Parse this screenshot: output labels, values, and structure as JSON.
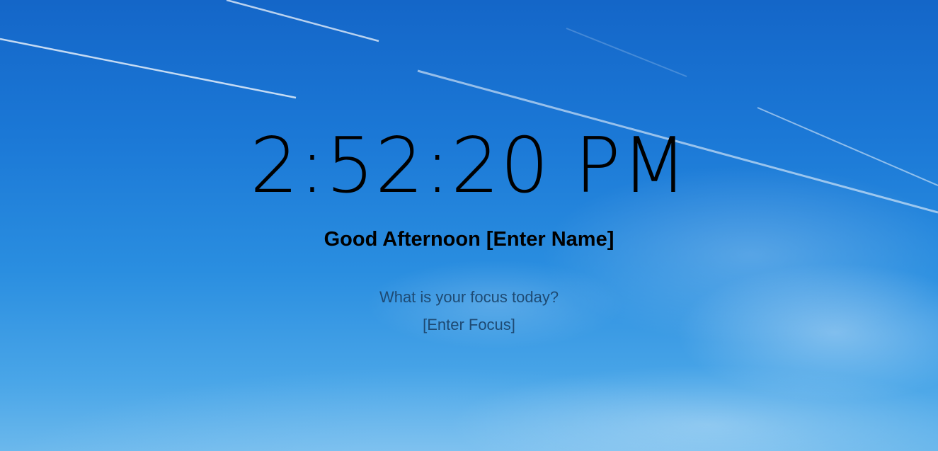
{
  "clock": {
    "time": "2:52:20 PM"
  },
  "greeting": {
    "salutation": "Good Afternoon",
    "name_placeholder": "[Enter Name]"
  },
  "focus": {
    "prompt": "What is your focus today?",
    "input_placeholder": "[Enter Focus]"
  },
  "colors": {
    "sky_top": "#1466c8",
    "sky_bottom": "#6bb8ec",
    "text_primary": "#000000",
    "text_secondary": "#1e4a73"
  }
}
